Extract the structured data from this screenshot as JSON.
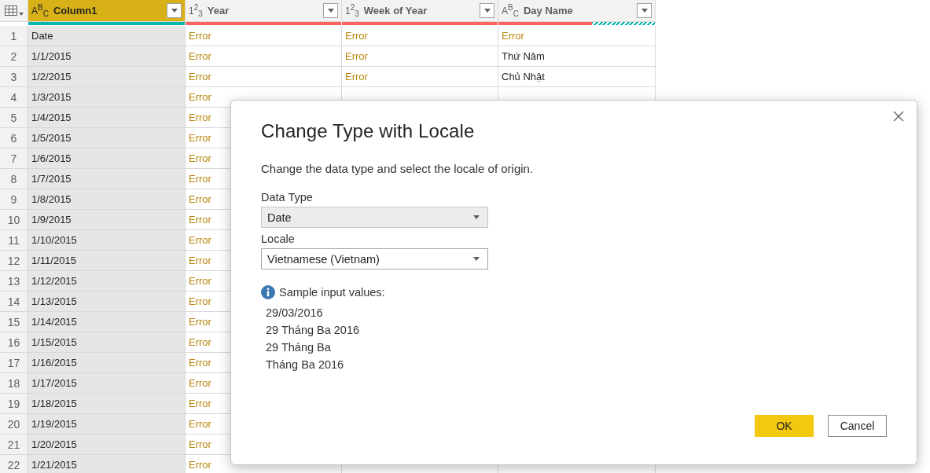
{
  "table": {
    "columns": [
      {
        "type_icon": "A$^{B}$$_{C}$",
        "title": "Column1",
        "selected": true,
        "quality_bar": [
          {
            "kind": "valid",
            "level": 1
          }
        ]
      },
      {
        "type_icon": "1$^{2}$$_{3}$",
        "title": "Year",
        "selected": false,
        "quality_bar": [
          {
            "kind": "error",
            "level": 1
          }
        ]
      },
      {
        "type_icon": "1$^{2}$$_{3}$",
        "title": "Week of Year",
        "selected": false,
        "quality_bar": [
          {
            "kind": "error",
            "level": 1
          }
        ]
      },
      {
        "type_icon": "A$^{B}$$_{C}$",
        "title": "Day Name",
        "selected": false,
        "quality_bar": [
          {
            "kind": "error",
            "level": 0.6
          },
          {
            "kind": "empty",
            "level": 0.4
          }
        ]
      }
    ],
    "rows": [
      {
        "number": "1",
        "cells": [
          {
            "text": "Date",
            "kind": "value"
          },
          {
            "text": "Error",
            "kind": "error"
          },
          {
            "text": "Error",
            "kind": "error"
          },
          {
            "text": "Error",
            "kind": "error"
          }
        ]
      },
      {
        "number": "2",
        "cells": [
          {
            "text": "1/1/2015",
            "kind": "value"
          },
          {
            "text": "Error",
            "kind": "error"
          },
          {
            "text": "Error",
            "kind": "error"
          },
          {
            "text": "Thứ Năm",
            "kind": "value"
          }
        ]
      },
      {
        "number": "3",
        "cells": [
          {
            "text": "1/2/2015",
            "kind": "value"
          },
          {
            "text": "Error",
            "kind": "error"
          },
          {
            "text": "Error",
            "kind": "error"
          },
          {
            "text": "Chủ Nhật",
            "kind": "value"
          }
        ]
      },
      {
        "number": "4",
        "cells": [
          {
            "text": "1/3/2015",
            "kind": "value"
          },
          {
            "text": "Error",
            "kind": "error"
          }
        ]
      },
      {
        "number": "5",
        "cells": [
          {
            "text": "1/4/2015",
            "kind": "value"
          },
          {
            "text": "Error",
            "kind": "error"
          }
        ]
      },
      {
        "number": "6",
        "cells": [
          {
            "text": "1/5/2015",
            "kind": "value"
          },
          {
            "text": "Error",
            "kind": "error"
          }
        ]
      },
      {
        "number": "7",
        "cells": [
          {
            "text": "1/6/2015",
            "kind": "value"
          },
          {
            "text": "Error",
            "kind": "error"
          }
        ]
      },
      {
        "number": "8",
        "cells": [
          {
            "text": "1/7/2015",
            "kind": "value"
          },
          {
            "text": "Error",
            "kind": "error"
          }
        ]
      },
      {
        "number": "9",
        "cells": [
          {
            "text": "1/8/2015",
            "kind": "value"
          },
          {
            "text": "Error",
            "kind": "error"
          }
        ]
      },
      {
        "number": "10",
        "cells": [
          {
            "text": "1/9/2015",
            "kind": "value"
          },
          {
            "text": "Error",
            "kind": "error"
          }
        ]
      },
      {
        "number": "11",
        "cells": [
          {
            "text": "1/10/2015",
            "kind": "value"
          },
          {
            "text": "Error",
            "kind": "error"
          }
        ]
      },
      {
        "number": "12",
        "cells": [
          {
            "text": "1/11/2015",
            "kind": "value"
          },
          {
            "text": "Error",
            "kind": "error"
          }
        ]
      },
      {
        "number": "13",
        "cells": [
          {
            "text": "1/12/2015",
            "kind": "value"
          },
          {
            "text": "Error",
            "kind": "error"
          }
        ]
      },
      {
        "number": "14",
        "cells": [
          {
            "text": "1/13/2015",
            "kind": "value"
          },
          {
            "text": "Error",
            "kind": "error"
          }
        ]
      },
      {
        "number": "15",
        "cells": [
          {
            "text": "1/14/2015",
            "kind": "value"
          },
          {
            "text": "Error",
            "kind": "error"
          }
        ]
      },
      {
        "number": "16",
        "cells": [
          {
            "text": "1/15/2015",
            "kind": "value"
          },
          {
            "text": "Error",
            "kind": "error"
          }
        ]
      },
      {
        "number": "17",
        "cells": [
          {
            "text": "1/16/2015",
            "kind": "value"
          },
          {
            "text": "Error",
            "kind": "error"
          }
        ]
      },
      {
        "number": "18",
        "cells": [
          {
            "text": "1/17/2015",
            "kind": "value"
          },
          {
            "text": "Error",
            "kind": "error"
          }
        ]
      },
      {
        "number": "19",
        "cells": [
          {
            "text": "1/18/2015",
            "kind": "value"
          },
          {
            "text": "Error",
            "kind": "error"
          }
        ]
      },
      {
        "number": "20",
        "cells": [
          {
            "text": "1/19/2015",
            "kind": "value"
          },
          {
            "text": "Error",
            "kind": "error"
          }
        ]
      },
      {
        "number": "21",
        "cells": [
          {
            "text": "1/20/2015",
            "kind": "value"
          },
          {
            "text": "Error",
            "kind": "error"
          }
        ]
      },
      {
        "number": "22",
        "cells": [
          {
            "text": "1/21/2015",
            "kind": "value"
          },
          {
            "text": "Error",
            "kind": "error"
          }
        ]
      }
    ]
  },
  "dialog": {
    "title": "Change Type with Locale",
    "description": "Change the data type and select the locale of origin.",
    "fields": [
      {
        "label": "Data Type",
        "value": "Date",
        "disabled": true
      },
      {
        "label": "Locale",
        "value": "Vietnamese (Vietnam)",
        "disabled": false
      }
    ],
    "sample_heading": "Sample input values:",
    "samples": [
      "29/03/2016",
      "29 Tháng Ba 2016",
      "29 Tháng Ba",
      "Tháng Ba 2016"
    ],
    "buttons": [
      {
        "label": "OK",
        "kind": "primary"
      },
      {
        "label": "Cancel",
        "kind": "secondary"
      }
    ]
  }
}
